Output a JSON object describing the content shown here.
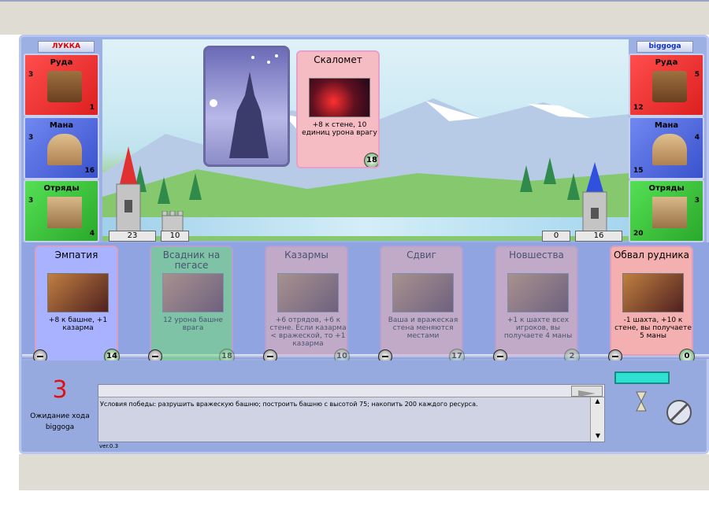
{
  "players": {
    "left": {
      "name": "ЛУККА",
      "name_color": "#e00000",
      "resources": [
        {
          "label": "Руда",
          "amount": "3",
          "production": "1"
        },
        {
          "label": "Мана",
          "amount": "3",
          "production": "16"
        },
        {
          "label": "Отряды",
          "amount": "3",
          "production": "4"
        }
      ],
      "tower": "23",
      "wall": "10"
    },
    "right": {
      "name": "biggoga",
      "name_color": "#1030c0",
      "resources": [
        {
          "label": "Руда",
          "amount": "5",
          "production": "12"
        },
        {
          "label": "Мана",
          "amount": "4",
          "production": "15"
        },
        {
          "label": "Отряды",
          "amount": "3",
          "production": "20"
        }
      ],
      "wall": "0",
      "tower": "16"
    }
  },
  "played_card": {
    "title": "Скаломет",
    "description": "+8 к стене, 10 единиц урона врагу",
    "cost": "18"
  },
  "hand": [
    {
      "title": "Эмпатия",
      "description": "+8 к башне, +1 казарма",
      "cost": "14",
      "type": "mana",
      "available": true
    },
    {
      "title": "Всадник на пегасе",
      "description": "12 урона башне врага",
      "cost": "18",
      "type": "recruits",
      "available": false
    },
    {
      "title": "Казармы",
      "description": "+6 отрядов, +6 к стене. Если казарма < вражеской, то +1 казарма",
      "cost": "10",
      "type": "bricks",
      "available": false
    },
    {
      "title": "Сдвиг",
      "description": "Ваша и вражеская стена меняются местами",
      "cost": "17",
      "type": "bricks",
      "available": false
    },
    {
      "title": "Новшества",
      "description": "+1 к шахте всех игроков, вы получаете 4 маны",
      "cost": "2",
      "type": "bricks",
      "available": false
    },
    {
      "title": "Обвал рудника",
      "description": "-1 шахта, +10 к стене, вы получаете 5 маны",
      "cost": "0",
      "type": "bricks",
      "available": true
    }
  ],
  "turn": {
    "counter": "3",
    "status": "Ожидание хода",
    "player": "biggoga"
  },
  "log": {
    "text": "Условия победы: разрушить вражескую башню; построить башню с высотой 75; накопить 200 каждого ресурса."
  },
  "version": "ver.0.3",
  "colors": {
    "bricks": "#ee4444",
    "gems": "#5570d8",
    "recruits": "#33bb33"
  }
}
